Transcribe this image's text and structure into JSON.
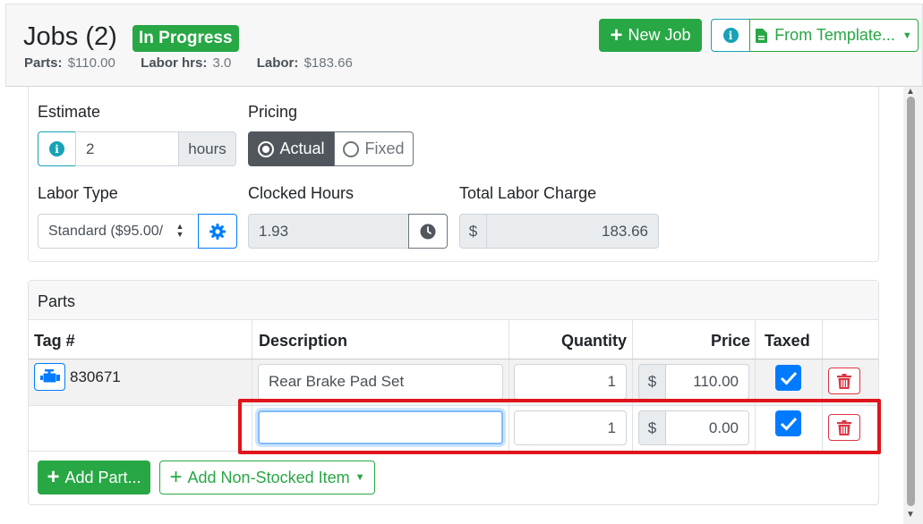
{
  "header": {
    "title": "Jobs (2)",
    "status_badge": "In Progress",
    "parts_label": "Parts:",
    "parts_value": "$110.00",
    "labor_hrs_label": "Labor hrs:",
    "labor_hrs_value": "3.0",
    "labor_label": "Labor:",
    "labor_value": "$183.66",
    "new_job_label": "New Job",
    "from_template_label": "From Template..."
  },
  "labor": {
    "estimate_label": "Estimate",
    "estimate_value": "2",
    "estimate_unit": "hours",
    "pricing_label": "Pricing",
    "pricing_actual": "Actual",
    "pricing_fixed": "Fixed",
    "labor_type_label": "Labor Type",
    "labor_type_value": "Standard ($95.00/",
    "clocked_hours_label": "Clocked Hours",
    "clocked_hours_value": "1.93",
    "total_labor_label": "Total Labor Charge",
    "total_labor_currency": "$",
    "total_labor_value": "183.66"
  },
  "parts": {
    "title": "Parts",
    "columns": [
      "Tag #",
      "Description",
      "Quantity",
      "Price",
      "Taxed"
    ],
    "rows": [
      {
        "tag": "830671",
        "description": "Rear Brake Pad Set",
        "quantity": "1",
        "currency": "$",
        "price": "110.00"
      },
      {
        "tag": "",
        "description": "",
        "quantity": "1",
        "currency": "$",
        "price": "0.00"
      }
    ],
    "add_part_label": "Add Part...",
    "add_non_stocked_label": "Add Non-Stocked Item"
  },
  "colors": {
    "green": "#28a745",
    "info": "#17a2b8",
    "primary": "#007bff",
    "danger": "#dc3545",
    "highlight": "#e0151b"
  }
}
